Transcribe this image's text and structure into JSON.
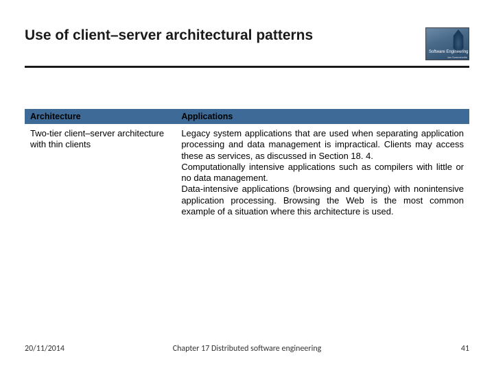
{
  "title": "Use of client–server architectural patterns",
  "logo": {
    "line1": "Software Engineering",
    "sub": "Ian Sommerville"
  },
  "table": {
    "headers": {
      "architecture": "Architecture",
      "applications": "Applications"
    },
    "row": {
      "architecture": "Two-tier client–server architecture with thin clients",
      "applications": "Legacy system applications that are used when separating application processing and data management is impractical. Clients may access these as services, as discussed in Section 18. 4.\nComputationally intensive applications such as compilers with little or no data management.\nData-intensive applications (browsing and querying) with nonintensive application processing. Browsing the Web is the most common example of a situation where this architecture is used."
    }
  },
  "footer": {
    "date": "20/11/2014",
    "chapter": "Chapter 17 Distributed software engineering",
    "page": "41"
  }
}
